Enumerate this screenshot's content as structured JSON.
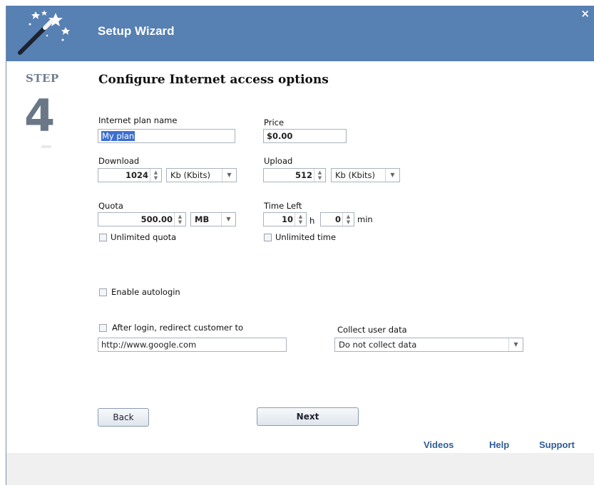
{
  "window": {
    "title": "Setup Wizard",
    "close_symbol": "×"
  },
  "step": {
    "word": "STEP",
    "number": "4"
  },
  "heading": "Configure Internet access options",
  "form": {
    "plan_name_label": "Internet plan name",
    "plan_name_value": "My plan",
    "price_label": "Price",
    "price_value": "$0.00",
    "download_label": "Download",
    "download_value": "1024",
    "download_unit": "Kb (Kbits)",
    "upload_label": "Upload",
    "upload_value": "512",
    "upload_unit": "Kb (Kbits)",
    "quota_label": "Quota",
    "quota_value": "500.00",
    "quota_unit": "MB",
    "time_left_label": "Time Left",
    "hours_value": "10",
    "hours_unit": "h",
    "minutes_value": "0",
    "minutes_unit": "min",
    "unlimited_quota_label": "Unlimited quota",
    "unlimited_time_label": "Unlimited time",
    "autologin_label": "Enable autologin",
    "redirect_label": "After login, redirect customer to",
    "redirect_url": "http://www.google.com",
    "collect_label": "Collect user data",
    "collect_value": "Do not collect data"
  },
  "buttons": {
    "back": "Back",
    "next": "Next"
  },
  "links": {
    "videos": "Videos",
    "help": "Help",
    "support": "Support"
  },
  "colors": {
    "header": "#5780b3",
    "link": "#2f5c97",
    "step": "#6a7787"
  }
}
